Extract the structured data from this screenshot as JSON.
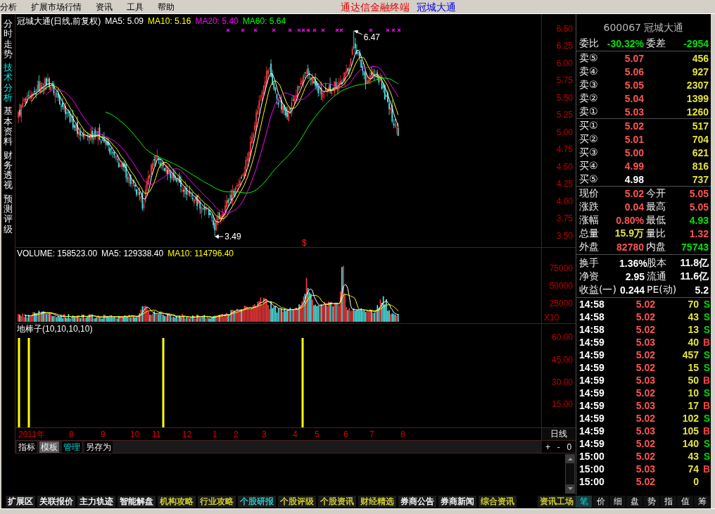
{
  "menu_bar": {
    "items": [
      "分析",
      "扩展市场行情",
      "资讯",
      "工具",
      "帮助"
    ],
    "app_title": "通达信金融终端",
    "stock_title": "冠城大通"
  },
  "side_tabs": [
    {
      "label": "分时走势",
      "selected": false
    },
    {
      "label": "技术分析",
      "selected": true
    },
    {
      "label": "基本资料",
      "selected": false
    },
    {
      "label": "财务透视",
      "selected": false
    },
    {
      "label": "预测评级",
      "selected": false
    }
  ],
  "price_panel": {
    "title": "冠城大通(日线,前复权)",
    "indicators": [
      {
        "text": "MA5: 5.09",
        "color": "#ffffff"
      },
      {
        "text": "MA10: 5.16",
        "color": "#ffff00"
      },
      {
        "text": "MA20: 5.40",
        "color": "#ff00ff"
      },
      {
        "text": "MA60: 5.64",
        "color": "#00ff00"
      }
    ],
    "axis": [
      "6.50",
      "6.25",
      "6.00",
      "5.75",
      "5.50",
      "5.25",
      "5.00",
      "4.75",
      "4.50",
      "4.25",
      "4.00",
      "3.75",
      "3.50"
    ],
    "high_label": "6.47",
    "low_label": "3.49",
    "signal_mark": "$"
  },
  "volume_panel": {
    "indicators": [
      {
        "text": "VOLUME: 158523.00",
        "color": "#ffffff"
      },
      {
        "text": "MA5: 129338.40",
        "color": "#ffffff"
      },
      {
        "text": "MA10: 114796.40",
        "color": "#ffff00"
      }
    ],
    "axis": [
      "75000",
      "50000",
      "25000"
    ],
    "unit": "X10"
  },
  "indicator_panel": {
    "title": "地棒子(10,10,10,10)",
    "axis": [
      "60.00",
      "45.00",
      "30.00",
      "15.00"
    ]
  },
  "date_axis": {
    "labels": [
      "2011年",
      "8",
      "9",
      "10",
      "11",
      "12",
      "1",
      "2",
      "3",
      "4",
      "5",
      "6",
      "7",
      "8"
    ],
    "period": "日线"
  },
  "template_tabs": [
    {
      "label": "指标",
      "selected": false,
      "highlighted": false
    },
    {
      "label": "模板",
      "selected": true,
      "highlighted": false
    },
    {
      "label": "管理",
      "selected": false,
      "highlighted": true
    },
    {
      "label": "另存为",
      "selected": false,
      "highlighted": false
    }
  ],
  "zoom_controls": [
    "+",
    "-",
    "0"
  ],
  "quote": {
    "header": "600067 冠城大通",
    "ratio": [
      {
        "label": "委比",
        "value": "-30.32%",
        "color": "#00e400"
      },
      {
        "label": "委差",
        "value": "-2954",
        "color": "#00e400"
      }
    ],
    "asks": [
      {
        "label": "卖⑤",
        "price": "5.07",
        "color": "#ff5454",
        "volume": "456"
      },
      {
        "label": "卖④",
        "price": "5.06",
        "color": "#ff5454",
        "volume": "927"
      },
      {
        "label": "卖③",
        "price": "5.05",
        "color": "#ff5454",
        "volume": "2307"
      },
      {
        "label": "卖②",
        "price": "5.04",
        "color": "#ff5454",
        "volume": "1399"
      },
      {
        "label": "卖①",
        "price": "5.03",
        "color": "#ff5454",
        "volume": "1260"
      }
    ],
    "bids": [
      {
        "label": "买①",
        "price": "5.02",
        "color": "#ff5454",
        "volume": "517"
      },
      {
        "label": "买②",
        "price": "5.01",
        "color": "#ff5454",
        "volume": "704"
      },
      {
        "label": "买③",
        "price": "5.00",
        "color": "#ff5454",
        "volume": "621"
      },
      {
        "label": "买④",
        "price": "4.99",
        "color": "#ff5454",
        "volume": "816"
      },
      {
        "label": "买⑤",
        "price": "4.98",
        "color": "#ffffff",
        "volume": "737"
      }
    ],
    "stats": [
      {
        "label": "现价",
        "value": "5.02",
        "color": "#ff5454"
      },
      {
        "label": "今开",
        "value": "5.05",
        "color": "#ff5454"
      },
      {
        "label": "涨跌",
        "value": "0.04",
        "color": "#ff5454"
      },
      {
        "label": "最高",
        "value": "5.05",
        "color": "#ff5454"
      },
      {
        "label": "涨幅",
        "value": "0.80%",
        "color": "#ff5454"
      },
      {
        "label": "最低",
        "value": "4.93",
        "color": "#00e400"
      },
      {
        "label": "总量",
        "value": "15.9万",
        "color": "#e4e43c"
      },
      {
        "label": "量比",
        "value": "1.32",
        "color": "#ff5454"
      },
      {
        "label": "外盘",
        "value": "82780",
        "color": "#ff5454"
      },
      {
        "label": "内盘",
        "value": "75743",
        "color": "#00e400"
      }
    ],
    "fundamentals": [
      {
        "label": "换手",
        "value": "1.36%",
        "color": "#ffffff"
      },
      {
        "label": "股本",
        "value": "11.8亿",
        "color": "#ffffff"
      },
      {
        "label": "净资",
        "value": "2.95",
        "color": "#ffffff"
      },
      {
        "label": "流通",
        "value": "11.6亿",
        "color": "#ffffff"
      },
      {
        "label": "收益(一)",
        "value": "0.244",
        "color": "#ffffff"
      },
      {
        "label": "PE(动)",
        "value": "5.2",
        "color": "#ffffff"
      }
    ],
    "trades": [
      {
        "time": "14:58",
        "price": "5.02",
        "volume": "70",
        "kind": "sell",
        "side": "S"
      },
      {
        "time": "14:58",
        "price": "5.02",
        "volume": "43",
        "kind": "sell",
        "side": "S"
      },
      {
        "time": "14:58",
        "price": "5.02",
        "volume": "13",
        "kind": "sell",
        "side": "S"
      },
      {
        "time": "14:59",
        "price": "5.03",
        "volume": "40",
        "kind": "buy",
        "side": "B"
      },
      {
        "time": "14:59",
        "price": "5.02",
        "volume": "457",
        "kind": "sell",
        "side": "S"
      },
      {
        "time": "14:59",
        "price": "5.02",
        "volume": "15",
        "kind": "sell",
        "side": "S"
      },
      {
        "time": "14:59",
        "price": "5.03",
        "volume": "50",
        "kind": "buy",
        "side": "B"
      },
      {
        "time": "14:59",
        "price": "5.02",
        "volume": "10",
        "kind": "sell",
        "side": "S"
      },
      {
        "time": "14:59",
        "price": "5.03",
        "volume": "17",
        "kind": "buy",
        "side": "B"
      },
      {
        "time": "14:59",
        "price": "5.02",
        "volume": "102",
        "kind": "sell",
        "side": "S"
      },
      {
        "time": "14:59",
        "price": "5.03",
        "volume": "105",
        "kind": "buy",
        "side": "B"
      },
      {
        "time": "14:59",
        "price": "5.02",
        "volume": "140",
        "kind": "sell",
        "side": "S"
      },
      {
        "time": "15:00",
        "price": "5.02",
        "volume": "43",
        "kind": "sell",
        "side": "S"
      },
      {
        "time": "15:00",
        "price": "5.03",
        "volume": "74",
        "kind": "buy",
        "side": "B"
      },
      {
        "time": "15:00",
        "price": "5.02",
        "volume": "0",
        "kind": "neutral"
      }
    ]
  },
  "bottom_tabs": [
    {
      "label": "扩展区",
      "color": "#ffffff"
    },
    {
      "label": "关联报价",
      "color": "#ffffff"
    },
    {
      "label": "主力轨迹",
      "color": "#ffffff"
    },
    {
      "label": "智能解盘",
      "color": "#ffffff"
    },
    {
      "label": "机构攻略",
      "color": "#d8d830"
    },
    {
      "label": "行业攻略",
      "color": "#d8d830"
    },
    {
      "label": "个股研报",
      "color": "#30d0d0"
    },
    {
      "label": "个股评级",
      "color": "#d8d830"
    },
    {
      "label": "个股资讯",
      "color": "#d8d830"
    },
    {
      "label": "财经精选",
      "color": "#d8d830"
    },
    {
      "label": "券商公告",
      "color": "#ffffff"
    },
    {
      "label": "券商新闻",
      "color": "#ffffff"
    },
    {
      "label": "综合资讯",
      "color": "#d8d830"
    }
  ],
  "info_tab": {
    "label": "资讯工场",
    "color": "#d8d830"
  },
  "detail_tabs": [
    {
      "label": "笔",
      "selected": true
    },
    {
      "label": "价",
      "selected": false
    },
    {
      "label": "细",
      "selected": false
    },
    {
      "label": "盘",
      "selected": false
    },
    {
      "label": "势",
      "selected": false
    },
    {
      "label": "指",
      "selected": false
    },
    {
      "label": "值",
      "selected": false
    },
    {
      "label": "筹",
      "selected": false
    }
  ]
}
